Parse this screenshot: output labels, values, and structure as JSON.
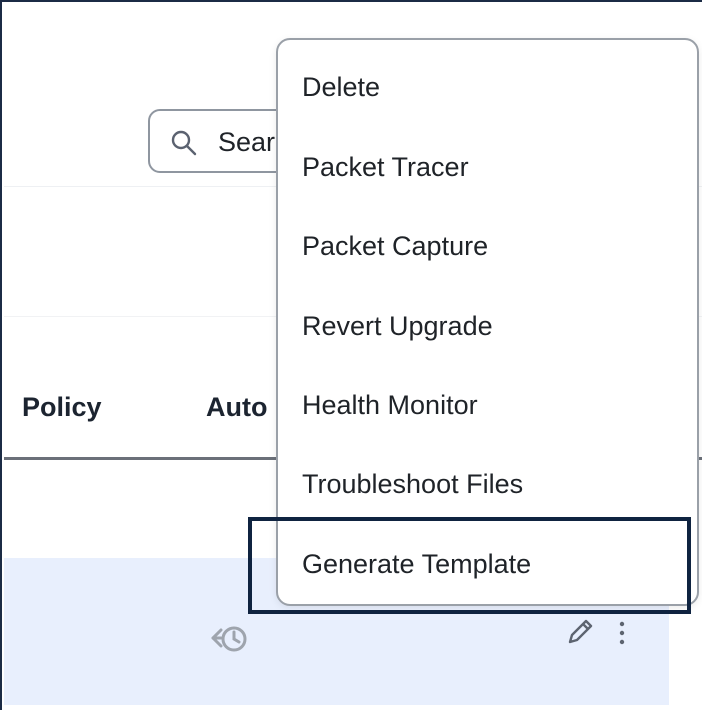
{
  "search": {
    "value": "Sear",
    "icon": "search-icon"
  },
  "table": {
    "columns": [
      "Policy",
      "Auto"
    ]
  },
  "row": {
    "icons": [
      "history-icon",
      "edit-icon",
      "more-vertical-icon"
    ]
  },
  "menu": {
    "items": [
      {
        "label": "Delete"
      },
      {
        "label": "Packet Tracer"
      },
      {
        "label": "Packet Capture"
      },
      {
        "label": "Revert Upgrade"
      },
      {
        "label": "Health Monitor"
      },
      {
        "label": "Troubleshoot Files"
      },
      {
        "label": "Generate Template"
      }
    ],
    "highlighted": "Generate Template"
  },
  "colors": {
    "row_highlight": "#e8effd",
    "highlight_box": "#0f2340",
    "text": "#1f2328"
  }
}
